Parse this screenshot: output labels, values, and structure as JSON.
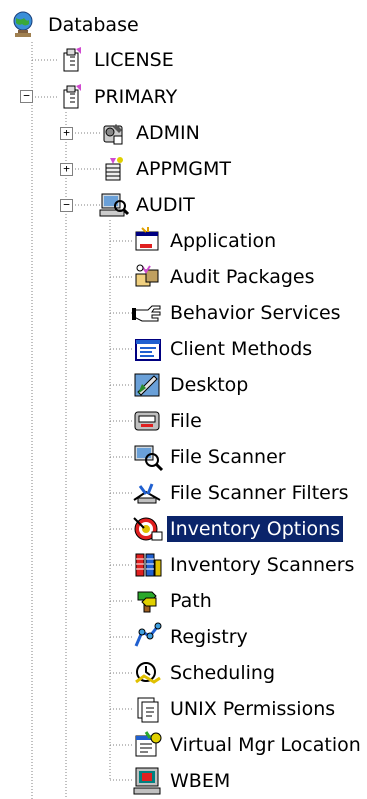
{
  "tree": {
    "root": {
      "label": "Database",
      "icon": "globe-database-icon"
    },
    "license": {
      "label": "LICENSE",
      "icon": "schema-folder-icon"
    },
    "primary": {
      "label": "PRIMARY",
      "icon": "schema-folder-icon",
      "expander": "−"
    },
    "admin": {
      "label": "ADMIN",
      "icon": "admin-tools-icon",
      "expander": "+"
    },
    "appmgmt": {
      "label": "APPMGMT",
      "icon": "appmgmt-icon",
      "expander": "+"
    },
    "audit": {
      "label": "AUDIT",
      "icon": "audit-computer-icon",
      "expander": "−"
    },
    "audit_items": [
      {
        "label": "Application",
        "icon": "application-icon"
      },
      {
        "label": "Audit Packages",
        "icon": "audit-packages-icon"
      },
      {
        "label": "Behavior Services",
        "icon": "behavior-services-icon"
      },
      {
        "label": "Client Methods",
        "icon": "client-methods-icon"
      },
      {
        "label": "Desktop",
        "icon": "desktop-icon"
      },
      {
        "label": "File",
        "icon": "file-icon"
      },
      {
        "label": "File Scanner",
        "icon": "file-scanner-icon"
      },
      {
        "label": "File Scanner Filters",
        "icon": "file-scanner-filters-icon"
      },
      {
        "label": "Inventory Options",
        "icon": "inventory-options-icon",
        "selected": true
      },
      {
        "label": "Inventory Scanners",
        "icon": "inventory-scanners-icon"
      },
      {
        "label": "Path",
        "icon": "path-icon"
      },
      {
        "label": "Registry",
        "icon": "registry-icon"
      },
      {
        "label": "Scheduling",
        "icon": "scheduling-icon"
      },
      {
        "label": "UNIX Permissions",
        "icon": "unix-permissions-icon"
      },
      {
        "label": "Virtual Mgr Location",
        "icon": "virtual-mgr-location-icon"
      },
      {
        "label": "WBEM",
        "icon": "wbem-icon"
      }
    ]
  },
  "colors": {
    "selection_bg": "#0a246a",
    "selection_fg": "#ffffff",
    "guide_line": "#808080"
  }
}
